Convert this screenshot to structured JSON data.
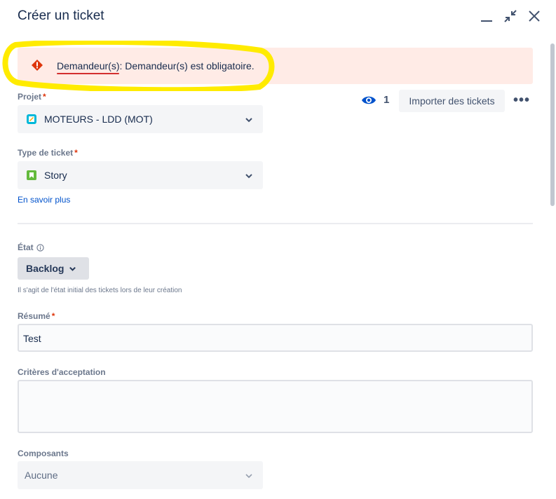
{
  "dialog": {
    "title": "Créer un ticket"
  },
  "error": {
    "field": "Demandeur(s)",
    "message": ": Demandeur(s) est obligatoire."
  },
  "project": {
    "label": "Projet",
    "required": "*",
    "value": "MOTEURS - LDD (MOT)",
    "icon": "project-icon"
  },
  "watch": {
    "count": "1"
  },
  "import_button": {
    "label": "Importer des tickets"
  },
  "more_button": {
    "label": "•••"
  },
  "ticket_type": {
    "label": "Type de ticket",
    "required": "*",
    "value": "Story",
    "icon": "story-icon",
    "link": "En savoir plus"
  },
  "state": {
    "label": "État",
    "value": "Backlog",
    "helper": "Il s'agit de l'état initial des tickets lors de leur création"
  },
  "summary": {
    "label": "Résumé",
    "required": "*",
    "value": "Test"
  },
  "acceptance": {
    "label": "Critères d'acceptation",
    "value": ""
  },
  "components": {
    "label": "Composants",
    "value": "Aucune"
  },
  "colors": {
    "error_bg": "#ffebe6",
    "error_icon": "#de350b",
    "highlight": "#ffeb00",
    "link": "#0052cc",
    "required": "#de350b"
  }
}
